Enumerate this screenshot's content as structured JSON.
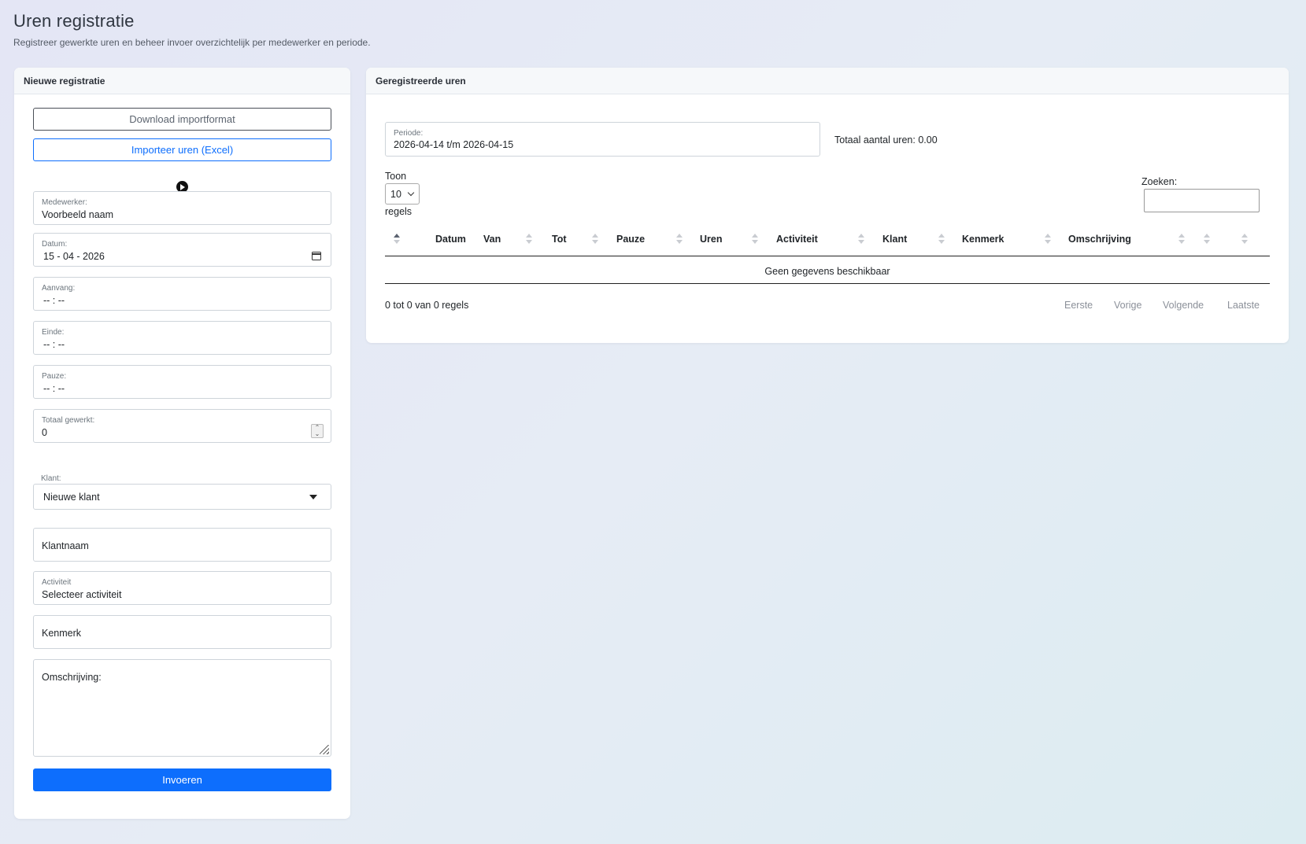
{
  "page": {
    "title": "Uren registratie",
    "subtitle": "Registreer gewerkte uren en beheer invoer overzichtelijk per medewerker en periode."
  },
  "left_card": {
    "header": "Nieuwe registratie",
    "download_label": "Download importformat",
    "import_label": "Importeer uren (Excel)",
    "employee": {
      "label": "Medewerker:",
      "value": "Voorbeeld naam"
    },
    "date": {
      "label": "Datum:",
      "value": "15 - 04 - 2026"
    },
    "start": {
      "label": "Aanvang:",
      "value": "-- : --"
    },
    "end": {
      "label": "Einde:",
      "value": "-- : --"
    },
    "pause": {
      "label": "Pauze:",
      "value": "-- : --"
    },
    "total": {
      "label": "Totaal gewerkt:",
      "value": "0"
    },
    "client": {
      "label": "Klant:",
      "selected": "Nieuwe klant"
    },
    "client_name": {
      "placeholder": "Klantnaam"
    },
    "activity": {
      "label": "Activiteit",
      "value": "Selecteer activiteit"
    },
    "reference": {
      "placeholder": "Kenmerk"
    },
    "description": {
      "placeholder": "Omschrijving:"
    },
    "submit_label": "Invoeren"
  },
  "right_card": {
    "header": "Geregistreerde uren",
    "period": {
      "label": "Periode:",
      "value": "2026-04-14 t/m 2026-04-15"
    },
    "total_hours": "Totaal aantal uren: 0.00",
    "show_label": "Toon",
    "page_length": "10",
    "rows_label": "regels",
    "search_label": "Zoeken:",
    "columns": [
      "Datum",
      "Van",
      "Tot",
      "Pauze",
      "Uren",
      "Activiteit",
      "Klant",
      "Kenmerk",
      "Omschrijving"
    ],
    "empty_message": "Geen gegevens beschikbaar",
    "info": "0 tot 0 van 0 regels",
    "pagination": {
      "first": "Eerste",
      "previous": "Vorige",
      "next": "Volgende",
      "last": "Laatste"
    }
  },
  "colors": {
    "primary": "#0d6efd",
    "text": "#212529",
    "muted": "#6c757d"
  }
}
